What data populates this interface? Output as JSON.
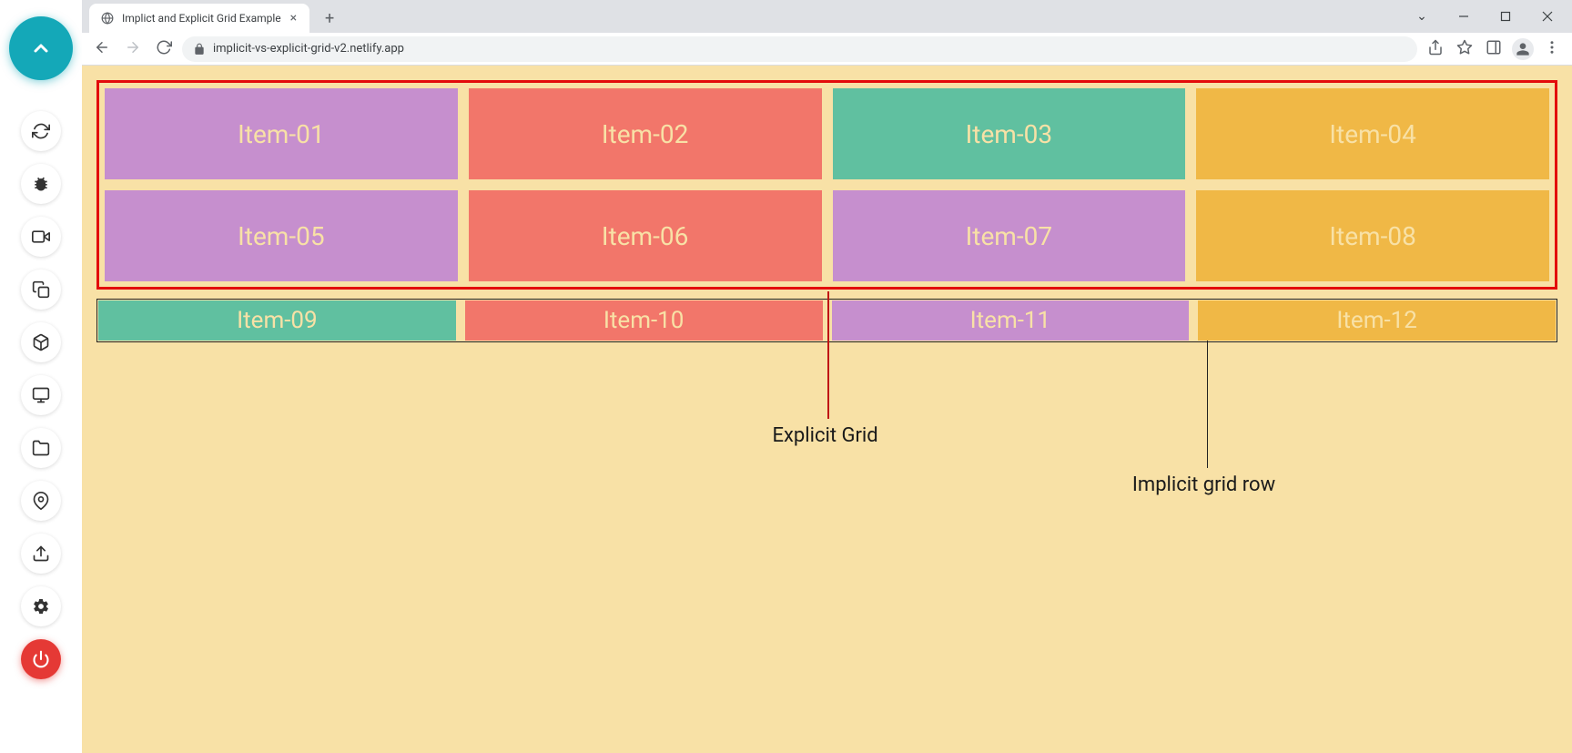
{
  "sidebar": {
    "items": [
      {
        "name": "collapse",
        "kind": "chevron-up",
        "big": true
      },
      {
        "name": "sync",
        "kind": "sync"
      },
      {
        "name": "bug",
        "kind": "bug"
      },
      {
        "name": "video",
        "kind": "video"
      },
      {
        "name": "copy",
        "kind": "copy"
      },
      {
        "name": "box",
        "kind": "box"
      },
      {
        "name": "monitor",
        "kind": "monitor"
      },
      {
        "name": "folder",
        "kind": "folder"
      },
      {
        "name": "location",
        "kind": "location"
      },
      {
        "name": "upload",
        "kind": "upload"
      },
      {
        "name": "settings",
        "kind": "gear"
      },
      {
        "name": "power",
        "kind": "power",
        "red": true
      }
    ]
  },
  "browser": {
    "tab_title": "Implict and Explicit Grid Example",
    "url": "implicit-vs-explicit-grid-v2.netlify.app"
  },
  "grid": {
    "explicit": [
      {
        "label": "Item-01",
        "color": "purple"
      },
      {
        "label": "Item-02",
        "color": "coral"
      },
      {
        "label": "Item-03",
        "color": "teal"
      },
      {
        "label": "Item-04",
        "color": "orange"
      },
      {
        "label": "Item-05",
        "color": "purple"
      },
      {
        "label": "Item-06",
        "color": "coral"
      },
      {
        "label": "Item-07",
        "color": "purple"
      },
      {
        "label": "Item-08",
        "color": "orange"
      }
    ],
    "implicit": [
      {
        "label": "Item-09",
        "color": "teal"
      },
      {
        "label": "Item-10",
        "color": "coral"
      },
      {
        "label": "Item-11",
        "color": "purple"
      },
      {
        "label": "Item-12",
        "color": "orange"
      }
    ]
  },
  "annotations": {
    "explicit_label": "Explicit Grid",
    "implicit_label": "Implicit grid row"
  }
}
